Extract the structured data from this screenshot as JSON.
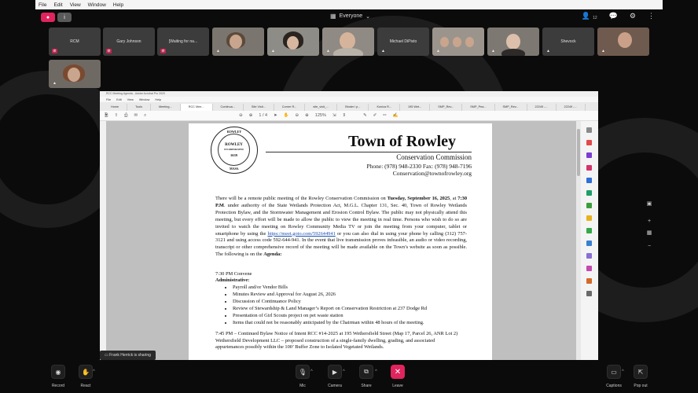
{
  "system_menu": [
    "File",
    "Edit",
    "View",
    "Window",
    "Help"
  ],
  "meeting": {
    "audience": "Everyone",
    "participant_count": "12",
    "sharing_text": "Frank Herrick is sharing"
  },
  "participants": [
    {
      "name": "RCM",
      "muted": true
    },
    {
      "name": "Gary Johnson",
      "muted": true
    },
    {
      "name": "[Waiting for na...",
      "muted": true
    },
    {
      "name": "",
      "muted": false,
      "video": true
    },
    {
      "name": "",
      "muted": false,
      "video": true
    },
    {
      "name": "",
      "muted": false,
      "video": true
    },
    {
      "name": "Michael DiPisto",
      "muted": false
    },
    {
      "name": "",
      "muted": false,
      "video": true
    },
    {
      "name": "",
      "muted": false,
      "video": true
    },
    {
      "name": "Shevock",
      "muted": false
    },
    {
      "name": "",
      "muted": false,
      "video": true
    },
    {
      "name": "",
      "muted": false,
      "video": true
    }
  ],
  "acrobat": {
    "title": "RCC Meeting Agenda - Adobe Acrobat Pro 2020",
    "menu": [
      "File",
      "Edit",
      "View",
      "Window",
      "Help"
    ],
    "tabs": [
      "Home",
      "Tools",
      "Meeting...",
      "RCC Mee...",
      "Continua...",
      "Site Visit...",
      "Corner R...",
      "site_visit_...",
      "Binder l p...",
      "Konica R...",
      "195 Wet...",
      "SMP_Rev...",
      "SMP_Pea...",
      "SMP_Rev...",
      "22249 -...",
      "22249 -..."
    ],
    "page_indicator": "1 / 4",
    "zoom": "125%"
  },
  "document": {
    "title": "Town of Rowley",
    "subtitle": "Conservation Commission",
    "phone": "Phone: (978) 948-2330 Fax: (978) 948-7196",
    "email": "Conservation@townofrowley.org",
    "seal_top": "ROWLEY",
    "seal_mid": "INCORPORATED",
    "seal_year": "1639",
    "seal_bottom": "MASS.",
    "para_a": "There will be a remote public meeting of the Rowley Conservation Commission on ",
    "para_date": "Tuesday, September 16, 2025",
    "para_b": ", at ",
    "para_time": "7:30 P.M",
    "para_c": ". under authority of the State Wetlands Protection Act, M.G.L. Chapter 131, Sec. 40, Town of Rowley Wetlands Protection Bylaw, and the Stormwater Management and Erosion Control Bylaw. The public may not physically attend this meeting, but every effort will be made to allow the public to view the meeting in real time. Persons who wish to do so are invited to watch the meeting on Rowley Community Media TV or join the meeting from your computer, tablet or smartphone by using the ",
    "para_link": "https://meet.goto.com/592644941",
    "para_d": " or you can also dial in using your phone by calling (312) 757-3121 and using access code 592-644-941. In the event that live transmission proves infeasible, an audio or video recording, transcript or other comprehensive record of the meeting will be made available on the Town’s website as soon as possible. The following is on the ",
    "para_agenda": "Agenda:",
    "convene": "7:30 PM     Convene",
    "admin_heading": "Administrative:",
    "admin_items": [
      "Payroll and/or Vendor Bills",
      "Minutes Review and Approval for August 26, 2026",
      "Discussion of Continuance Policy",
      "Review of Stewardship & Land Manager’s Report on Conservation Restriction at 237 Dodge Rd",
      "Presentation of Girl Scouts project on pet waste station",
      "Items that could not be reasonably anticipated by the Chairman within 48 hours of the meeting."
    ],
    "item_745": "7:45 PM – Continued Bylaw Notice of Intent RCC #14-2025 at 195 Wethersfield Street (Map 17, Parcel 26, ANR Lot 2) Wethersfield Development LLC – proposed construction of a single-family dwelling, grading, and associated appurtenances possibly within the 100’ Buffer Zone to Isolated Vegetated Wetlands."
  },
  "bottom_bar": {
    "record": "Record",
    "react": "React",
    "mic": "Mic",
    "camera": "Camera",
    "share": "Share",
    "leave": "Leave",
    "captions": "Captions",
    "popout": "Pop out"
  },
  "colors": {
    "accent": "#e0245e",
    "tile": "#3c3c3c",
    "link": "#1a4fb3"
  }
}
